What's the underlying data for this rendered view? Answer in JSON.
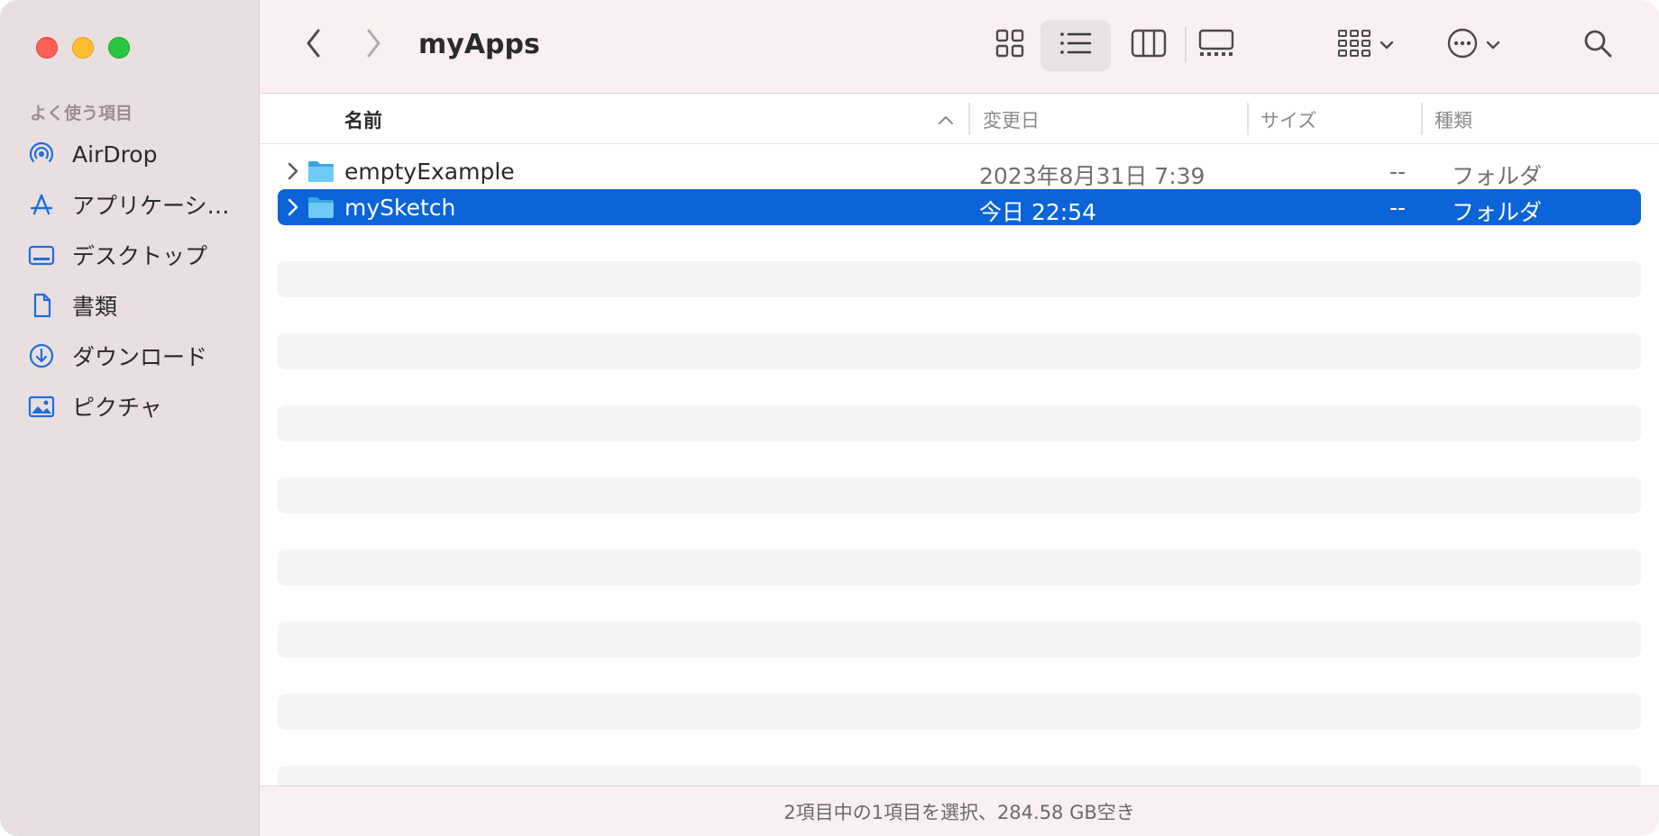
{
  "window": {
    "title": "myApps"
  },
  "sidebar": {
    "section_title": "よく使う項目",
    "items": [
      {
        "label": "AirDrop",
        "icon": "airdrop-icon"
      },
      {
        "label": "アプリケーシ…",
        "icon": "applications-icon"
      },
      {
        "label": "デスクトップ",
        "icon": "desktop-icon"
      },
      {
        "label": "書類",
        "icon": "document-icon"
      },
      {
        "label": "ダウンロード",
        "icon": "download-icon"
      },
      {
        "label": "ピクチャ",
        "icon": "pictures-icon"
      }
    ]
  },
  "toolbar": {
    "back_icon": "chevron-left-icon",
    "forward_icon": "chevron-right-icon",
    "views": [
      "icon-view",
      "list-view",
      "column-view",
      "gallery-view"
    ],
    "selected_view": "list-view"
  },
  "columns": {
    "name": "名前",
    "modified": "変更日",
    "size": "サイズ",
    "kind": "種類"
  },
  "rows": [
    {
      "name": "emptyExample",
      "date": "2023年8月31日 7:39",
      "size": "--",
      "kind": "フォルダ",
      "selected": false
    },
    {
      "name": "mySketch",
      "date": "今日 22:54",
      "size": "--",
      "kind": "フォルダ",
      "selected": true
    }
  ],
  "status": {
    "text": "2項目中の1項目を選択、284.58 GB空き"
  },
  "colors": {
    "accent": "#0a64d8",
    "folder": "#5ec2f2",
    "sidebar_icon": "#1e6fd9"
  }
}
